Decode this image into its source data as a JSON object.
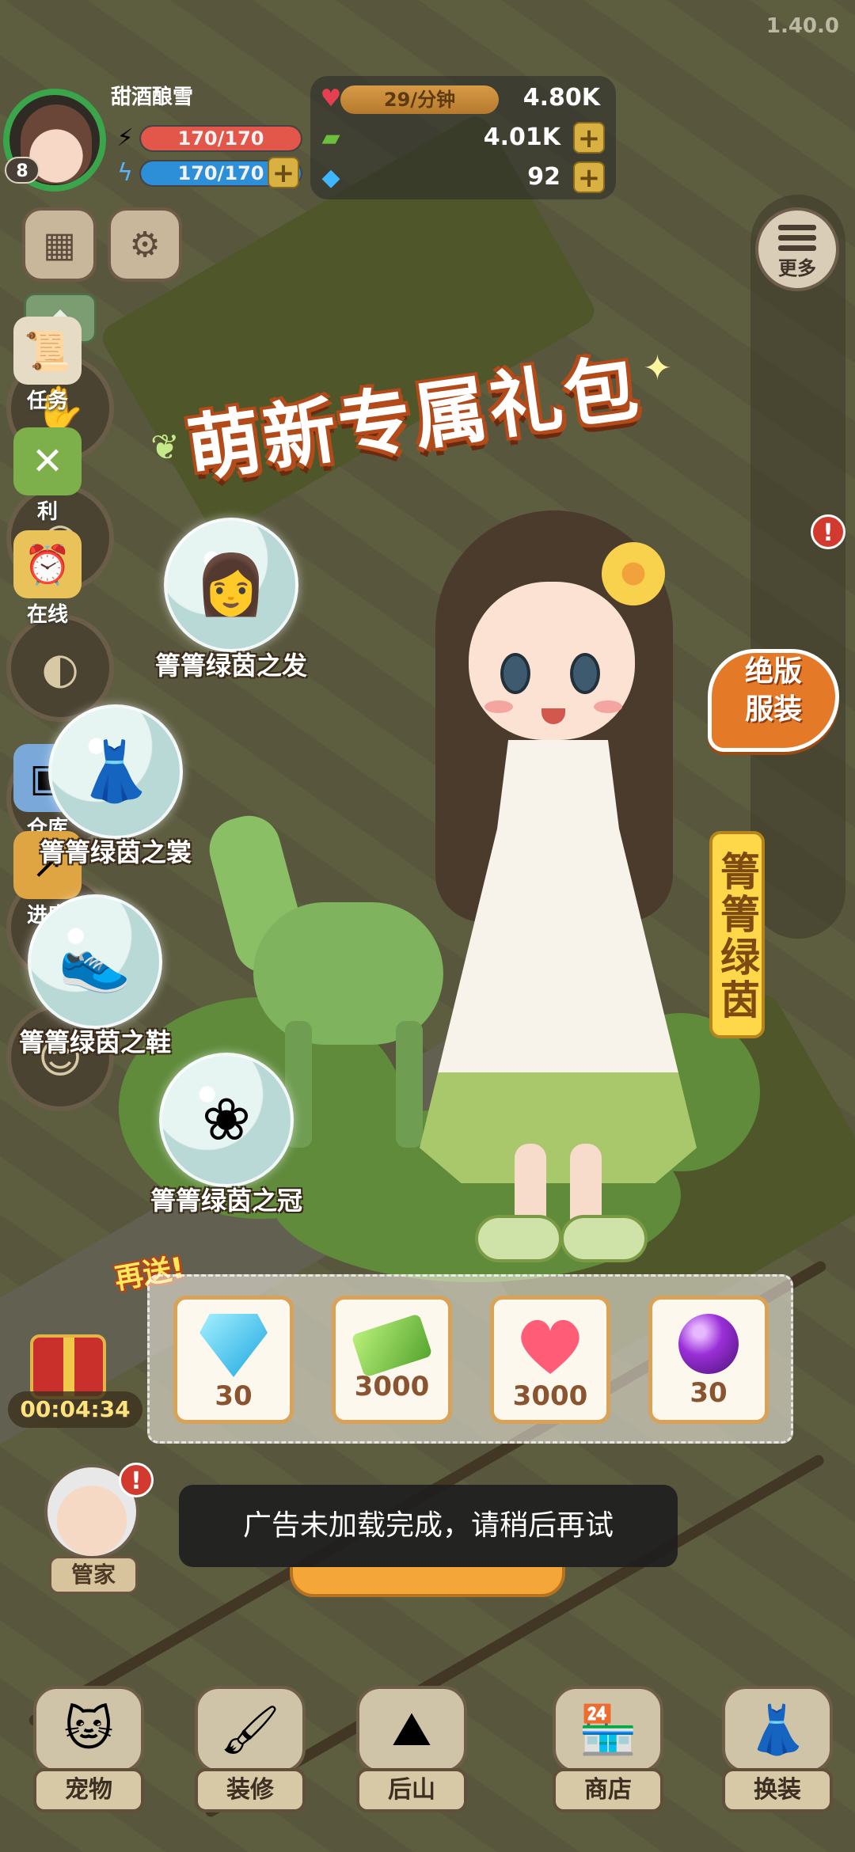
{
  "version": "1.40.0",
  "player": {
    "name": "甜酒酿雪",
    "level": "8",
    "energy": "170/170",
    "stamina": "170/170"
  },
  "resources": {
    "heart_rate": "29/分钟",
    "hearts": "4.80K",
    "cash": "4.01K",
    "diamonds": "92"
  },
  "right_menu": {
    "more": "更多",
    "tasks": "任务",
    "welfare": "利",
    "online": "在线",
    "warehouse": "仓库",
    "progress": "进度",
    "badge": "!"
  },
  "popup": {
    "title": "萌新专属礼包",
    "edition_line1": "绝版",
    "edition_line2": "服装",
    "outfit_name": "箐箐绿茵",
    "items": [
      {
        "label": "箐箐绿茵之发",
        "icon": "hair-icon"
      },
      {
        "label": "箐箐绿茵之裳",
        "icon": "dress-icon"
      },
      {
        "label": "箐箐绿茵之鞋",
        "icon": "shoes-icon"
      },
      {
        "label": "箐箐绿茵之冠",
        "icon": "crown-icon"
      }
    ],
    "bonus_label": "再送!",
    "rewards": [
      {
        "icon": "diamond-icon",
        "value": "30"
      },
      {
        "icon": "cash-icon",
        "value": "3000"
      },
      {
        "icon": "heart-icon",
        "value": "3000"
      },
      {
        "icon": "orb-icon",
        "value": "30"
      }
    ]
  },
  "toast": "广告未加载完成，请稍后再试",
  "gift_timer": "00:04:34",
  "steward_label": "管家",
  "nav": [
    {
      "label": "宠物",
      "icon": "cat-icon"
    },
    {
      "label": "装修",
      "icon": "paint-icon"
    },
    {
      "label": "后山",
      "icon": "mountain-icon"
    },
    {
      "label": "商店",
      "icon": "shop-icon"
    },
    {
      "label": "换装",
      "icon": "dress-icon"
    }
  ],
  "colors": {
    "accent_orange": "#e47a28",
    "gold": "#ffd84a",
    "energy_red": "#e2574a",
    "stamina_blue": "#2d8fd8",
    "toast_bg": "#1e1e1e"
  }
}
